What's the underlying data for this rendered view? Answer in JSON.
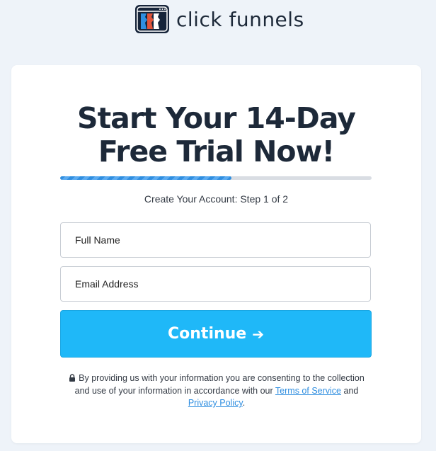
{
  "brand": {
    "name": "click funnels",
    "colors": {
      "mark_bg": "#16243a",
      "mark_red": "#e0533a",
      "mark_blue": "#2f8ee0"
    }
  },
  "signup": {
    "headline_line1": "Start Your 14-Day",
    "headline_line2": "Free Trial Now!",
    "progress": {
      "fraction": 0.55,
      "color": "#2f8ee0"
    },
    "step_text": "Create Your Account: Step 1 of 2",
    "full_name": {
      "value": "",
      "placeholder": "Full Name"
    },
    "email": {
      "value": "",
      "placeholder": "Email Address"
    },
    "continue_label": "Continue",
    "continue_icon": "arrow-right-icon",
    "button_color": "#1fb8f8",
    "disclaimer": {
      "lock_icon": "lock-icon",
      "text_before": "By providing us with your information you are consenting to the collection and use of your information in accordance with our",
      "terms_link": "Terms of Service",
      "and_text": "and",
      "privacy_link": "Privacy Policy",
      "end_text": "."
    }
  }
}
